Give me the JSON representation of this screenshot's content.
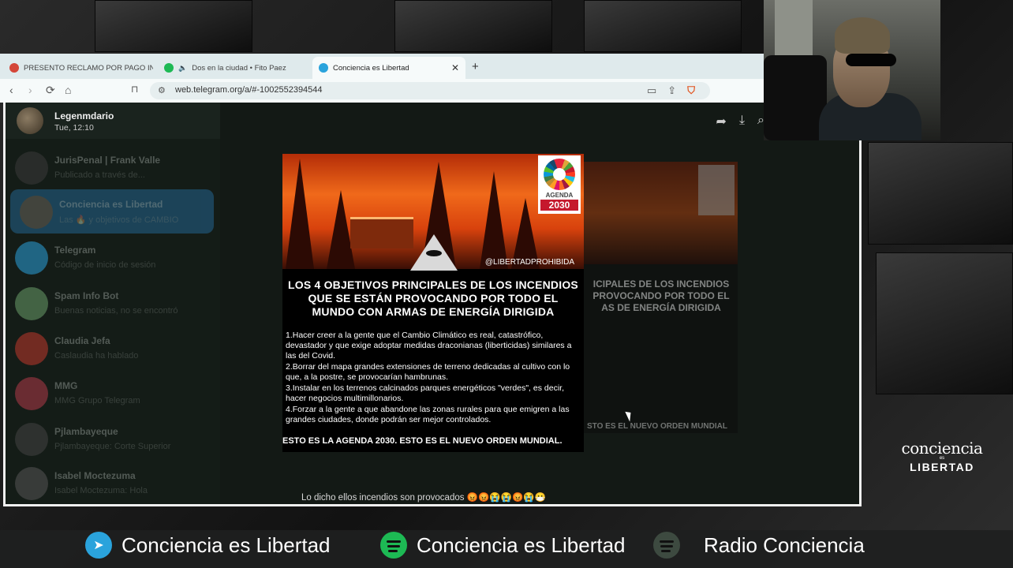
{
  "browser": {
    "tabs": [
      {
        "label": "PRESENTO RECLAMO POR PAGO IN",
        "color": "#d44638"
      },
      {
        "label": "Dos en la ciudad • Fito Paez",
        "color": "#1db954"
      },
      {
        "label": "Conciencia es Libertad",
        "color": "#2aa3dc"
      }
    ],
    "new_tab": "+",
    "close": "✕",
    "url": "web.telegram.org/a/#-1002552394544"
  },
  "telegram": {
    "profile": {
      "name": "Legenmdario",
      "time": "Tue, 12:10"
    },
    "chats": [
      {
        "name": "JurisPenal | Frank Valle",
        "preview": "Publicado a través de...",
        "color": "#3a3a3a"
      },
      {
        "name": "Conciencia es Libertad",
        "preview": "Las 🔥 y objetivos de CAMBIO",
        "color": "#6b4a2a"
      },
      {
        "name": "Telegram",
        "preview": "Código de inicio de sesión",
        "color": "#2aa3dc"
      },
      {
        "name": "Spam Info Bot",
        "preview": "Buenas noticias, no se encontró",
        "color": "#6a9f6a"
      },
      {
        "name": "Claudia Jefa",
        "preview": "Caslaudia ha hablado",
        "color": "#c0392b"
      },
      {
        "name": "MMG",
        "preview": "MMG Grupo Telegram",
        "color": "#b03a48"
      },
      {
        "name": "Pjlambayeque",
        "preview": "Pjlambayeque: Corte Superior",
        "color": "#444"
      },
      {
        "name": "Isabel Moctezuma",
        "preview": "Isabel Moctezuma: Hola",
        "color": "#555"
      }
    ],
    "post": {
      "handle": "@LIBERTADPROHIBIDA",
      "agenda_top": "AGENDA",
      "agenda_year": "2030",
      "headline": [
        "LOS 4 OBJETIVOS PRINCIPALES DE LOS INCENDIOS",
        "QUE SE ESTÁN PROVOCANDO POR TODO EL",
        "MUNDO CON ARMAS DE ENERGÍA DIRIGIDA"
      ],
      "items": [
        "1.Hacer creer a la gente que el Cambio Climático es real, catastrófico, devastador y que exige adoptar medidas draconianas (liberticidas) similares a las del Covid.",
        "2.Borrar del mapa grandes extensiones de terreno dedicadas al cultivo con lo que, a la postre, se provocarían hambrunas.",
        "3.Instalar en los terrenos calcinados parques energéticos \"verdes\", es decir, hacer negocios multimillonarios.",
        "4.Forzar a la gente a que abandone las zonas rurales para que emigren a las grandes ciudades, donde podrán ser mejor controlados."
      ],
      "footer": "ESTO ES LA AGENDA 2030. ESTO ES EL NUEVO ORDEN MUNDIAL.",
      "caption": "Lo dicho ellos incendios son provocados 😡😡😭😭😡😭😷"
    },
    "ghost": {
      "headline": "ICIPALES DE LOS INCENDIOS PROVOCANDO POR TODO EL AS DE ENERGÍA DIRIGIDA",
      "footer": "STO ES EL NUEVO ORDEN MUNDIAL"
    }
  },
  "brand": {
    "line1": "conciencia",
    "line2": "es",
    "line3": "LIBERTAD"
  },
  "bottom_bar": [
    {
      "label": "Conciencia es Libertad",
      "icon": "telegram-icon"
    },
    {
      "label": "Conciencia es Libertad",
      "icon": "spotify-icon"
    },
    {
      "label": "Radio Conciencia",
      "icon": "spotify-icon"
    }
  ]
}
